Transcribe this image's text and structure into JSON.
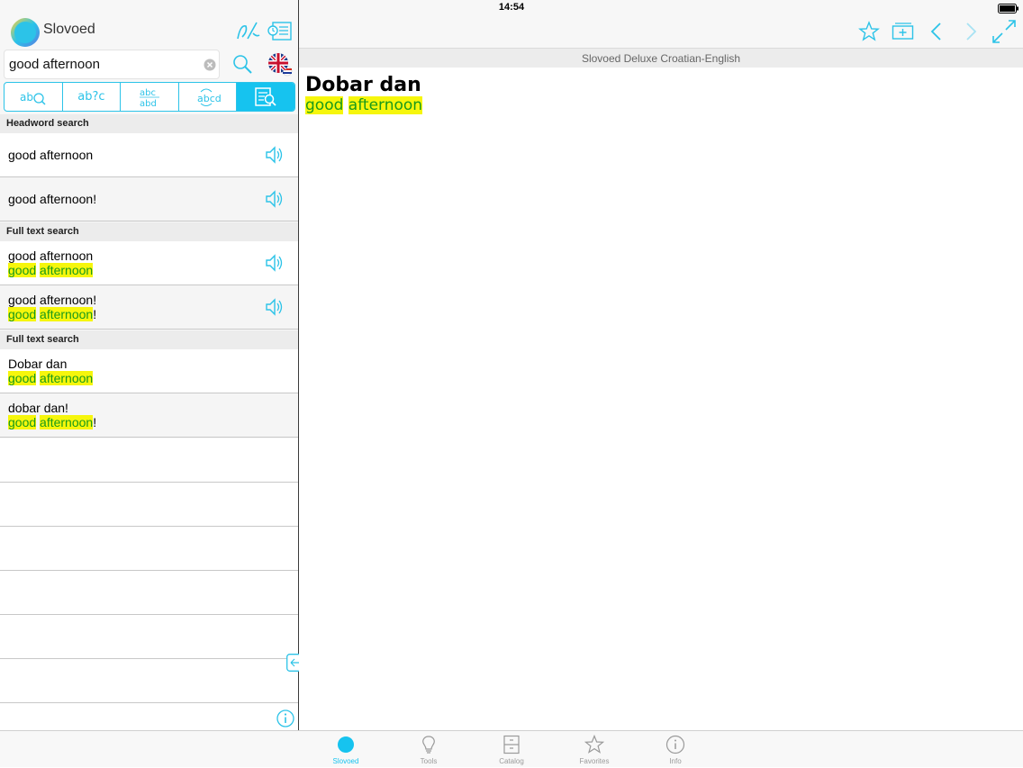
{
  "status_bar": {
    "time": "14:54"
  },
  "app": {
    "title": "Slovoed"
  },
  "search": {
    "value": "good afternoon",
    "placeholder": ""
  },
  "search_modes": [
    {
      "label": "ab",
      "icon": "headword-search-icon",
      "active": false
    },
    {
      "label": "ab?c",
      "icon": "wildcard-search-icon",
      "active": false
    },
    {
      "label": "abc/abd",
      "icon": "fuzzy-search-icon",
      "active": false
    },
    {
      "label": "abcd",
      "icon": "anagram-search-icon",
      "active": false
    },
    {
      "label": "",
      "icon": "full-text-search-icon",
      "active": true
    }
  ],
  "results": {
    "headword_header": "Headword search",
    "headword_items": [
      {
        "title": "good afternoon"
      },
      {
        "title": "good afternoon!"
      }
    ],
    "fulltext_header_1": "Full text search",
    "fulltext_items_1": [
      {
        "title": "good afternoon",
        "w1": "good",
        "w2": "afternoon",
        "tail": ""
      },
      {
        "title": "good afternoon!",
        "w1": "good",
        "w2": "afternoon",
        "tail": "!"
      }
    ],
    "fulltext_header_2": "Full text search",
    "fulltext_items_2": [
      {
        "title": "Dobar dan",
        "w1": "good",
        "w2": "afternoon",
        "tail": ""
      },
      {
        "title": "dobar dan!",
        "w1": "good",
        "w2": "afternoon",
        "tail": "!"
      }
    ]
  },
  "article": {
    "dictionary_name": "Slovoed Deluxe Croatian-English",
    "headword": "Dobar dan",
    "w1": "good",
    "w2": "afternoon"
  },
  "tabbar": [
    {
      "label": "Slovoed",
      "icon": "slovoed-icon",
      "active": true
    },
    {
      "label": "Tools",
      "icon": "lightbulb-icon",
      "active": false
    },
    {
      "label": "Catalog",
      "icon": "cabinet-icon",
      "active": false
    },
    {
      "label": "Favorites",
      "icon": "star-icon",
      "active": false
    },
    {
      "label": "Info",
      "icon": "info-icon",
      "active": false
    }
  ],
  "colors": {
    "accent": "#16c3ef",
    "highlight_bg": "#f6f60c",
    "highlight_text": "#1a9a1a"
  }
}
